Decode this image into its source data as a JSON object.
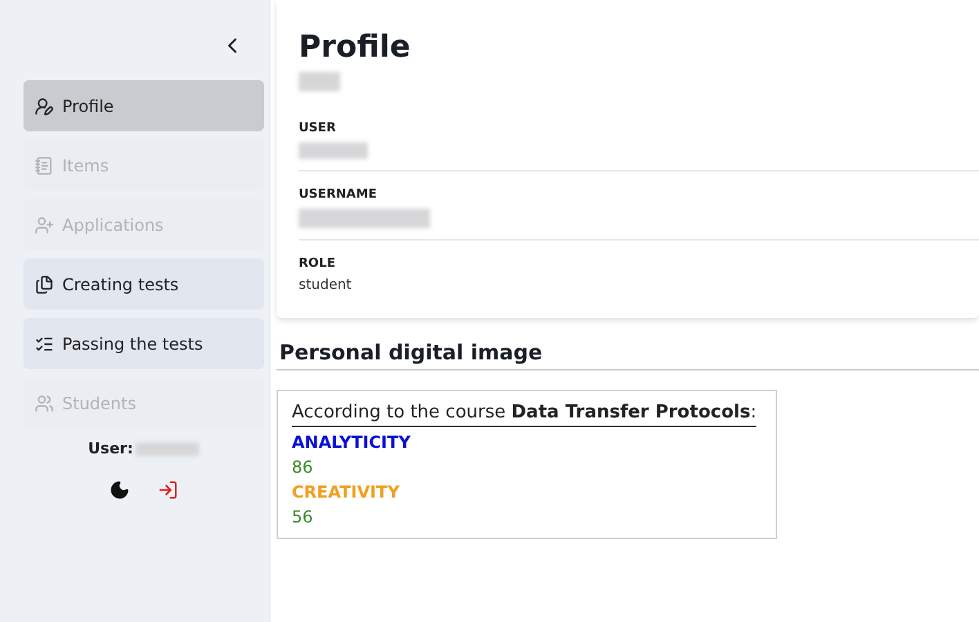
{
  "sidebar": {
    "items": [
      {
        "label": "Profile",
        "selected": true,
        "disabled": false
      },
      {
        "label": "Items",
        "selected": false,
        "disabled": true
      },
      {
        "label": "Applications",
        "selected": false,
        "disabled": true
      },
      {
        "label": "Creating tests",
        "selected": false,
        "disabled": false
      },
      {
        "label": "Passing the tests",
        "selected": false,
        "disabled": false
      },
      {
        "label": "Students",
        "selected": false,
        "disabled": true
      }
    ],
    "user_label": "User:"
  },
  "profile": {
    "title": "Profile",
    "fields": [
      {
        "label": "USER"
      },
      {
        "label": "USERNAME"
      },
      {
        "label": "ROLE",
        "value": "student"
      }
    ]
  },
  "digital_image": {
    "title": "Personal digital image",
    "intro": "According to the course **Data Transfer Protocols**:",
    "metrics": [
      {
        "name": "ANALYTICITY",
        "color": "#0a10d8",
        "value": "86"
      },
      {
        "name": "CREATIVITY",
        "color": "#f0a020",
        "value": "56"
      }
    ]
  }
}
